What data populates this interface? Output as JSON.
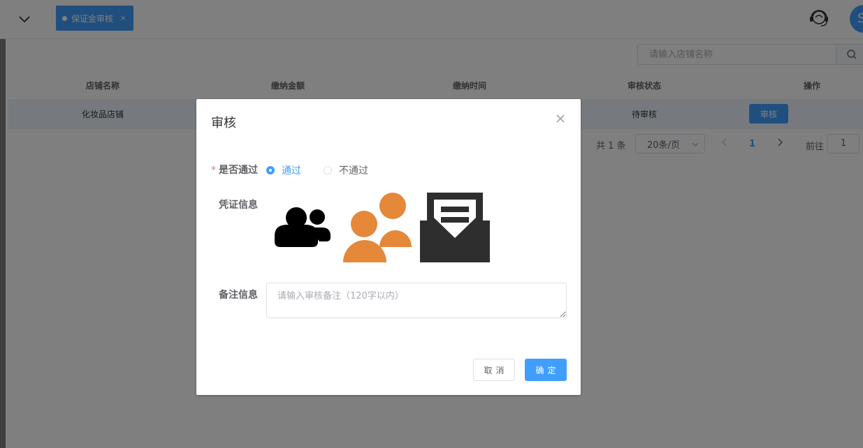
{
  "header": {
    "tab_label": "保证金审核",
    "tab_close": "×",
    "avatar_text": "S"
  },
  "search": {
    "placeholder": "请输入店铺名称"
  },
  "table": {
    "columns": [
      "店铺名称",
      "缴纳金额",
      "缴纳时间",
      "审核状态",
      "操作"
    ],
    "rows": [
      {
        "shop_name": "化妆品店铺",
        "amount": "",
        "time": "",
        "status": "待审核",
        "action": "审核"
      }
    ]
  },
  "pagination": {
    "total": "共 1 条",
    "page_size": "20条/页",
    "current_page": "1",
    "goto_label": "前往",
    "goto_value": "1"
  },
  "dialog": {
    "title": "审核",
    "pass_label": "是否通过",
    "required_mark": "*",
    "option_pass": "通过",
    "option_reject": "不通过",
    "selected": "通过",
    "voucher_label": "凭证信息",
    "vouchers": [
      "users-icon",
      "people-icon",
      "mail-icon"
    ],
    "remark_label": "备注信息",
    "remark_placeholder": "请输入审核备注（120字以内）",
    "cancel_label": "取消",
    "confirm_label": "确定"
  },
  "colors": {
    "primary": "#409eff",
    "voucher_orange": "#e5883a",
    "voucher_dark": "#2e2e2e"
  }
}
